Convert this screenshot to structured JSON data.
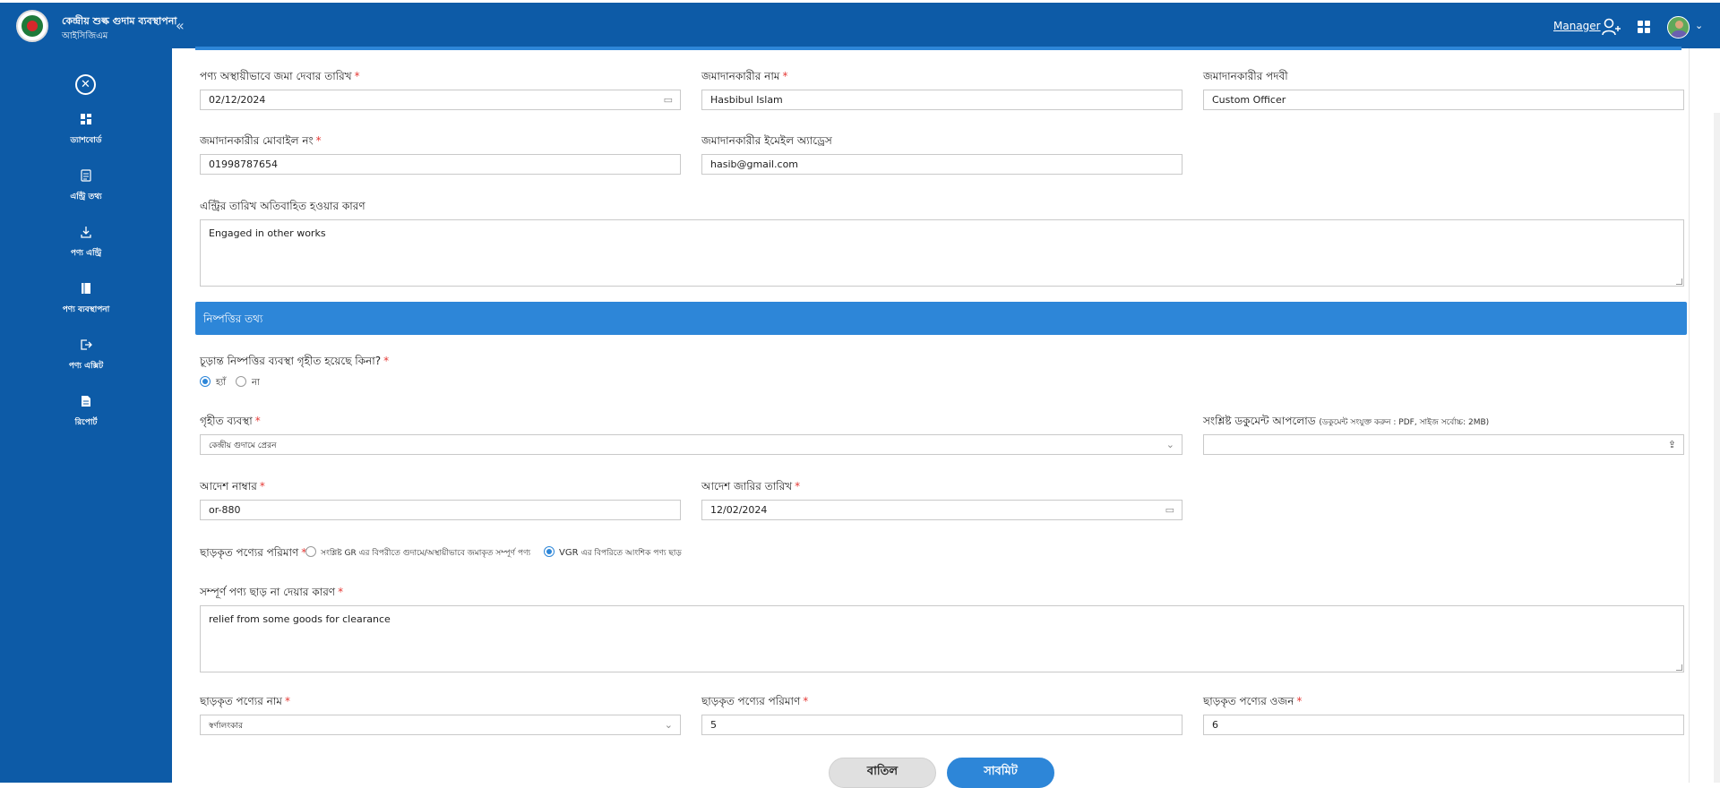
{
  "header": {
    "app_title": "কেন্দ্রীয় শুল্ক গুদাম ব্যবস্থাপনা",
    "app_subtitle": "আইসিজিএম",
    "collapse_glyph": "«",
    "role_link": "Manager",
    "brand_color": "#0d5ba7",
    "accent_color": "#2d86d8"
  },
  "sidebar": {
    "close_glyph": "✕",
    "items": [
      {
        "icon": "dashboard-icon",
        "label": "ড্যাশবোর্ড"
      },
      {
        "icon": "entry-info-icon",
        "label": "এন্ট্রি তথ্য"
      },
      {
        "icon": "download-icon",
        "label": "পণ্য এন্ট্রি"
      },
      {
        "icon": "book-icon",
        "label": "পণ্য ব্যবস্থাপনা"
      },
      {
        "icon": "exit-icon",
        "label": "পণ্য এক্সিট"
      },
      {
        "icon": "report-icon",
        "label": "রিপোর্ট"
      }
    ]
  },
  "form": {
    "deposit_date": {
      "label": "পণ্য অস্থায়ীভাবে জমা দেবার তারিখ",
      "value": "02/12/2024"
    },
    "depositor_name": {
      "label": "জমাদানকারীর নাম",
      "value": "Hasbibul Islam"
    },
    "depositor_designation": {
      "label": "জমাদানকারীর পদবী",
      "value": "Custom Officer"
    },
    "depositor_mobile": {
      "label": "জমাদানকারীর মোবাইল নং",
      "value": "01998787654"
    },
    "depositor_email": {
      "label": "জমাদানকারীর ইমেইল অ্যাড্রেস",
      "value": "hasib@gmail.com"
    },
    "delay_reason": {
      "label": "এন্ট্রির তারিখ অতিবাহিত হওয়ার কারণ",
      "value": "Engaged in other works"
    },
    "section_title": "নিষ্পত্তির তথ্য",
    "final_decision": {
      "label": "চূড়ান্ত নিষ্পত্তির ব্যবস্থা গৃহীত হয়েছে কিনা?",
      "yes": "হ্যাঁ",
      "no": "না",
      "selected": "yes"
    },
    "action_taken": {
      "label": "গৃহীত ব্যবস্থা",
      "value": "কেন্দ্রীয় গুদামে প্রেরন"
    },
    "document_upload": {
      "label": "সংশ্লিষ্ট ডকুমেন্ট আপলোড",
      "note": "(ডকুমেন্ট সংযুক্ত করুন : PDF, সাইজ সর্বোচ্চ: 2MB)"
    },
    "order_number": {
      "label": "আদেশ নাম্বার",
      "value": "or-880"
    },
    "order_date": {
      "label": "আদেশ জারির তারিখ",
      "value": "12/02/2024"
    },
    "released_quantity_type": {
      "label": "ছাড়কৃত পণ্যের পরিমাণ",
      "option_full": "সংশ্লিষ্ট GR এর বিপরীতে গুদামে/অস্থায়ীভাবে জমাকৃত সম্পূর্ণ পণ্য",
      "option_partial_code": "VGR",
      "option_partial": "এর বিপরিতে আংশিক পণ্য ছাড়",
      "selected": "partial"
    },
    "not_full_release_reason": {
      "label": "সম্পূর্ণ পণ্য ছাড় না দেয়ার কারণ",
      "value": "relief from some goods for clearance"
    },
    "released_goods_name": {
      "label": "ছাড়কৃত পণ্যের নাম",
      "value": "স্বর্ণালংকার"
    },
    "released_goods_quantity": {
      "label": "ছাড়কৃত পণ্যের পরিমাণ",
      "value": "5"
    },
    "released_goods_weight": {
      "label": "ছাড়কৃত পণ্যের ওজন",
      "value": "6"
    },
    "required_marker": "*"
  },
  "actions": {
    "cancel": "বাতিল",
    "submit": "সাবমিট"
  }
}
